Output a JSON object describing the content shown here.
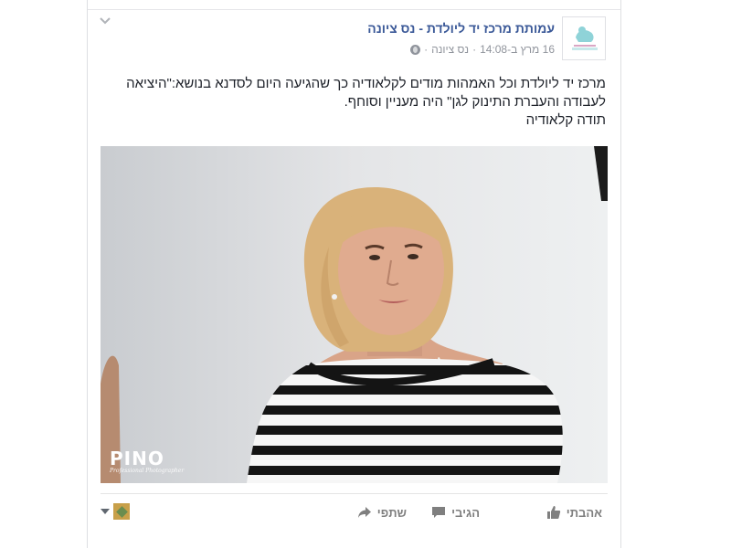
{
  "post": {
    "page_name": "עמותת מרכז יד ליולדת - נס ציונה",
    "timestamp": "16 מרץ ב-14:08",
    "separator": "·",
    "location": "נס ציונה",
    "text_lines": [
      "מרכז יד ליולדת וכל האמהות מודים לקלאודיה כך שהגיעה היום לסדנא בנושא:\"היציאה",
      "לעבודה והעברת התינוק לגן\" היה מעניין וסוחף.",
      "תודה קלאודיה"
    ],
    "photo_watermark": {
      "main": "PINO",
      "sub": "Professional Photographer"
    }
  },
  "actions": {
    "like_label": "אהבתי",
    "comment_label": "הגיבי",
    "share_label": "שתפי"
  },
  "icons": {
    "options": "chevron-down-icon",
    "privacy": "globe-icon",
    "like": "thumbs-up-icon",
    "comment": "comment-icon",
    "share": "share-arrow-icon",
    "viewer_menu": "caret-down-icon"
  },
  "colors": {
    "link_blue": "#3b5998",
    "meta_gray": "#90949c",
    "action_gray": "#7f7f7f",
    "text": "#1d2129"
  }
}
